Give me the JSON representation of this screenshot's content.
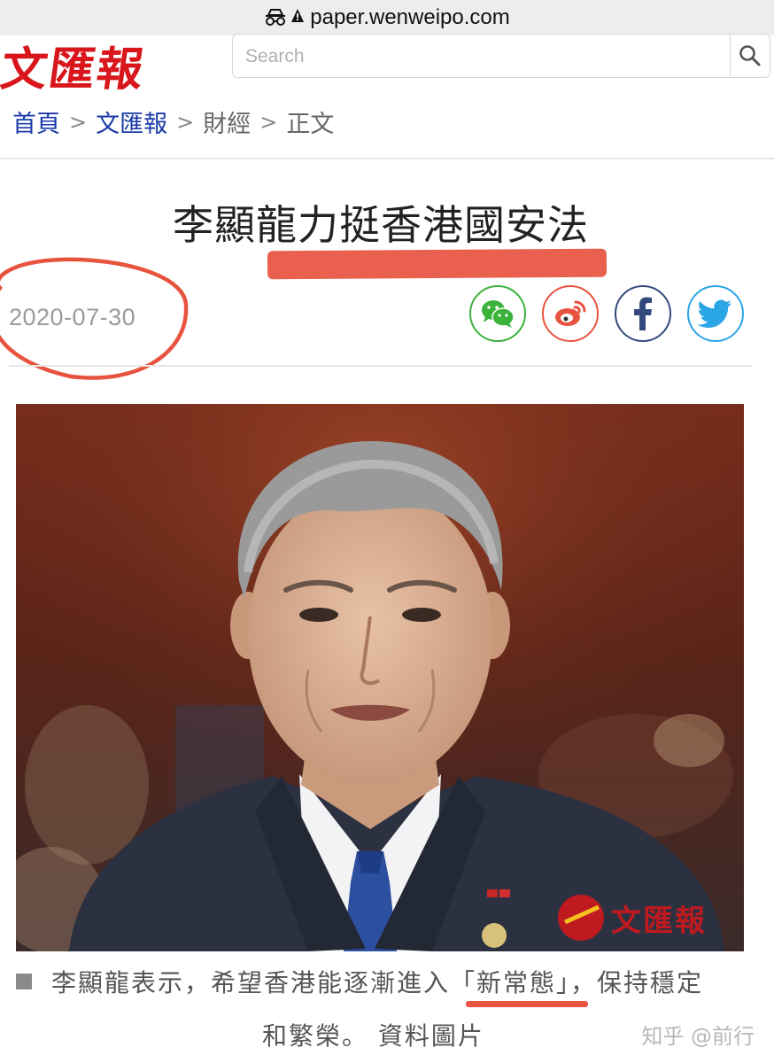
{
  "browser": {
    "url": "paper.wenweipo.com"
  },
  "header": {
    "logo_text": "文匯報",
    "search_placeholder": "Search"
  },
  "breadcrumb": {
    "home": "首頁",
    "paper": "文匯報",
    "section": "財經",
    "current": "正文",
    "separator": ">"
  },
  "article": {
    "headline": "李顯龍力挺香港國安法",
    "date": "2020-07-30",
    "photo_watermark": "文匯報",
    "caption_line1": "李顯龍表示，希望香港能逐漸進入「新常態」，保持穩定",
    "caption_line2": "和繁榮。 資料圖片"
  },
  "share": {
    "icons": [
      "wechat-icon",
      "weibo-icon",
      "facebook-icon",
      "twitter-icon"
    ]
  },
  "annotations": {
    "highlight_color": "#e8533f"
  },
  "watermark": "知乎 @前行",
  "colors": {
    "logo_red": "#d8161b",
    "link_blue": "#1a3aa8",
    "wechat_green": "#3bb33b",
    "weibo_orange": "#e8533f",
    "facebook_blue": "#34497e",
    "twitter_blue": "#2aa5e6"
  }
}
